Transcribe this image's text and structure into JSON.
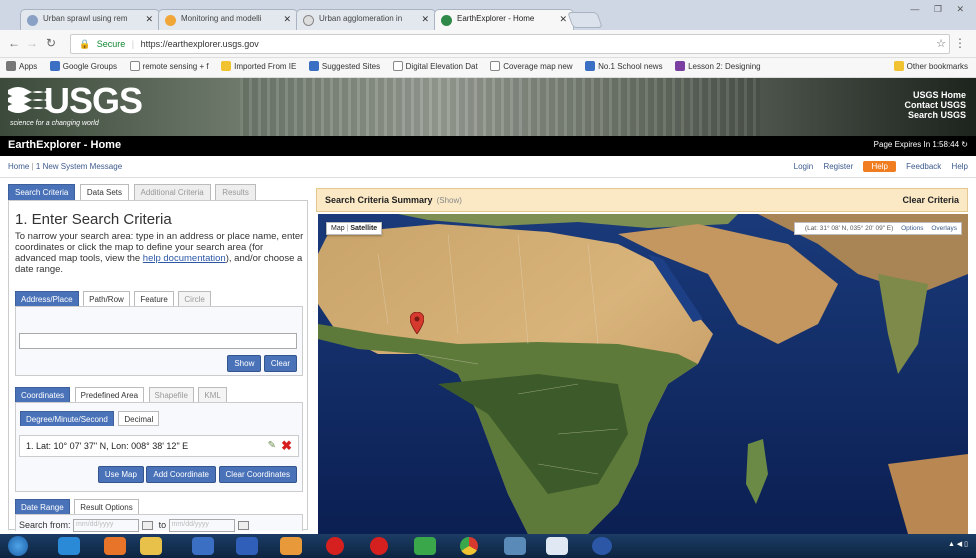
{
  "browser": {
    "tabs": [
      {
        "label": "Urban sprawl using rem",
        "active": false
      },
      {
        "label": "Monitoring and modelli",
        "active": false
      },
      {
        "label": "Urban agglomeration in",
        "active": false
      },
      {
        "label": "EarthExplorer - Home",
        "active": true
      }
    ],
    "secure_label": "Secure",
    "url": "https://earthexplorer.usgs.gov",
    "bookmarks": [
      {
        "label": "Apps",
        "icon": "apps-icon"
      },
      {
        "label": "Google Groups",
        "icon": "google-groups-icon"
      },
      {
        "label": "remote sensing + f",
        "icon": "google-search-icon"
      },
      {
        "label": "Imported From IE",
        "icon": "folder-icon"
      },
      {
        "label": "Suggested Sites",
        "icon": "suggested-sites-icon"
      },
      {
        "label": "Digital Elevation Dat",
        "icon": "page-icon"
      },
      {
        "label": "Coverage map new",
        "icon": "page-icon"
      },
      {
        "label": "No.1 School news",
        "icon": "news-icon"
      },
      {
        "label": "Lesson 2: Designing",
        "icon": "lesson-icon"
      },
      {
        "label": "Other bookmarks",
        "icon": "folder-icon"
      }
    ]
  },
  "banner": {
    "logo_text": "USGS",
    "tagline": "science for a changing world",
    "links": [
      "USGS Home",
      "Contact USGS",
      "Search USGS"
    ]
  },
  "titlebar": {
    "title": "EarthExplorer - Home",
    "expires": "Page Expires In 1:58:44"
  },
  "subnav": {
    "home": "Home",
    "message": "1 New System Message",
    "login": "Login",
    "register": "Register",
    "button": "Help",
    "feedback": "Feedback",
    "help": "Help"
  },
  "left": {
    "tabs": [
      "Search Criteria",
      "Data Sets",
      "Additional Criteria",
      "Results"
    ],
    "heading": "1. Enter Search Criteria",
    "instructions_pre": "To narrow your search area: type in an address or place name, enter coordinates or click the map to define your search area (for advanced map tools, view the ",
    "instructions_link": "help documentation",
    "instructions_post": "), and/or choose a date range.",
    "addr_tabs": [
      "Address/Place",
      "Path/Row",
      "Feature",
      "Circle"
    ],
    "show_btn": "Show",
    "clear_btn": "Clear",
    "coord_tabs": [
      "Coordinates",
      "Predefined Area",
      "Shapefile",
      "KML"
    ],
    "format_tabs": [
      "Degree/Minute/Second",
      "Decimal"
    ],
    "coordinate": "1. Lat: 10° 07' 37\" N, Lon: 008° 38' 12\" E",
    "coord_buttons": [
      "Use Map",
      "Add Coordinate",
      "Clear Coordinates"
    ],
    "date_tabs": [
      "Date Range",
      "Result Options"
    ],
    "search_from": "Search from:",
    "to": "to",
    "date_placeholder": "mm/dd/yyyy"
  },
  "map": {
    "summary_title": "Search Criteria Summary",
    "summary_show": "(Show)",
    "clear_criteria": "Clear Criteria",
    "map_type": "Map",
    "satellite": "Satellite",
    "latlon": "(Lat: 31° 08' N, 035° 20' 09\" E)",
    "options": "Options",
    "overlays": "Overlays"
  },
  "colors": {
    "usgs_blue": "#4a72b8",
    "orange": "#f07d20",
    "summary_bg": "#fbe9c6",
    "delete_red": "#d62020"
  }
}
